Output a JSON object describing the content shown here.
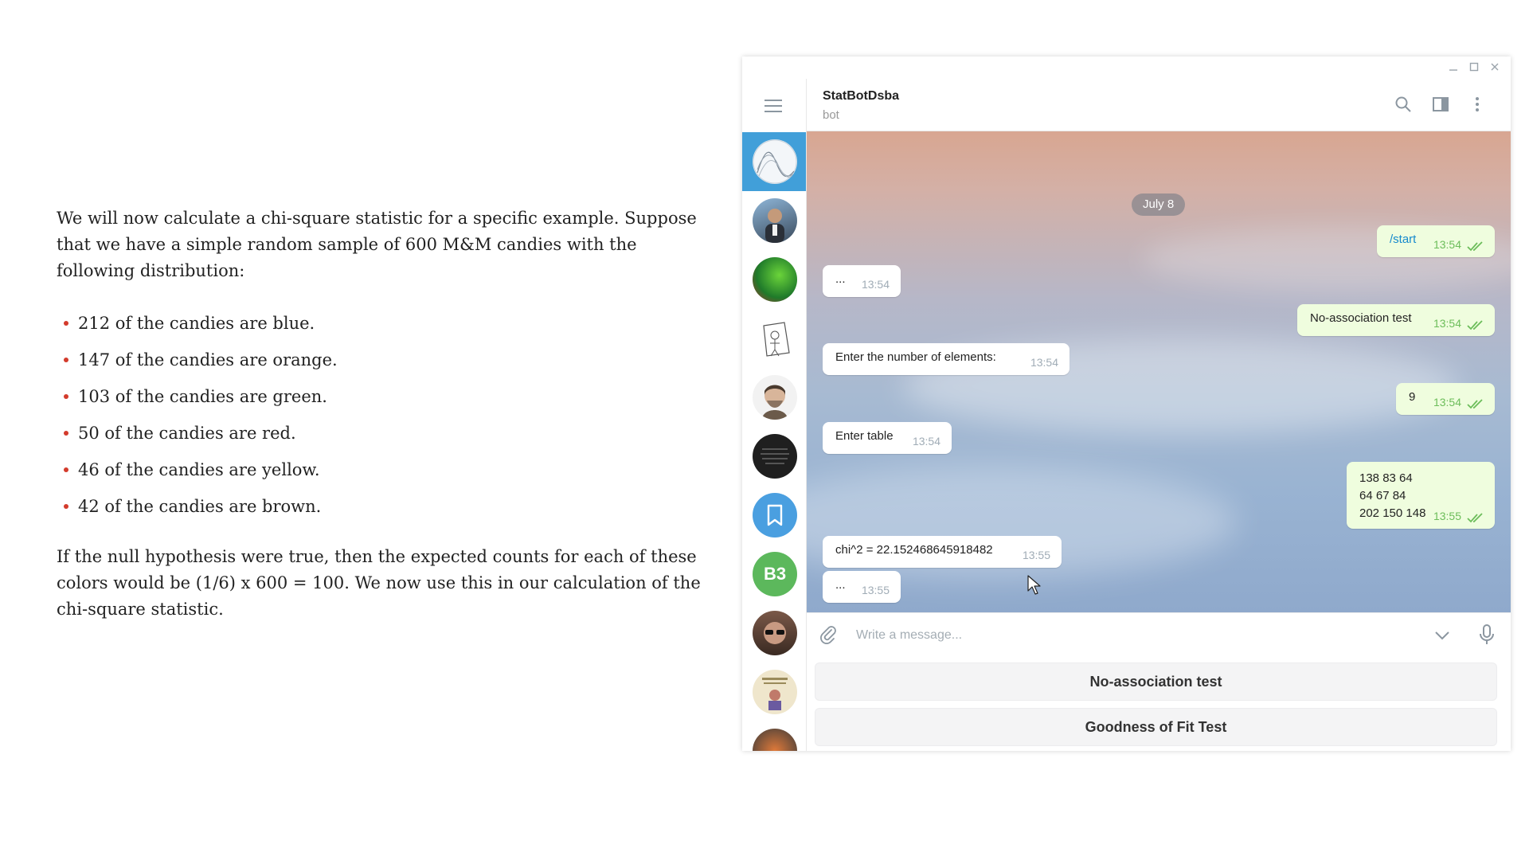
{
  "article": {
    "intro": "We will now calculate a chi-square statistic for a specific example. Suppose that we have a simple random sample of 600 M&M candies with the following distribution:",
    "items": [
      "212 of the candies are blue.",
      "147 of the candies are orange.",
      "103 of the candies are green.",
      "50 of the candies are red.",
      "46 of the candies are yellow.",
      "42 of the candies are brown."
    ],
    "outro": "If the null hypothesis were true, then the expected counts for each of these colors would be (1/6) x 600 = 100. We now use this in our calculation of the chi-square statistic."
  },
  "window": {
    "controls": [
      "minimize-icon",
      "maximize-icon",
      "close-icon"
    ]
  },
  "sidebar": {
    "menu_icon": "hamburger-menu-icon",
    "chats": [
      {
        "name": "statbot-avatar",
        "active": true
      },
      {
        "name": "chat-avatar-2"
      },
      {
        "name": "chat-avatar-3"
      },
      {
        "name": "chat-avatar-4"
      },
      {
        "name": "chat-avatar-5"
      },
      {
        "name": "chat-avatar-6"
      },
      {
        "name": "saved-messages-avatar",
        "icon": "bookmark-icon"
      },
      {
        "name": "chat-avatar-b3",
        "letters": "B3"
      },
      {
        "name": "chat-avatar-9"
      },
      {
        "name": "chat-avatar-10"
      },
      {
        "name": "chat-avatar-11"
      }
    ]
  },
  "header": {
    "title": "StatBotDsba",
    "subtitle": "bot",
    "icons": [
      "search-icon",
      "sidebar-toggle-icon",
      "more-vertical-icon"
    ]
  },
  "chat": {
    "date": "July 8",
    "messages": [
      {
        "dir": "out",
        "text": "/start",
        "time": "13:54"
      },
      {
        "dir": "in",
        "text": "...",
        "time": "13:54"
      },
      {
        "dir": "out",
        "text": "No-association test",
        "time": "13:54"
      },
      {
        "dir": "in",
        "text": "Enter the number of elements:",
        "time": "13:54"
      },
      {
        "dir": "out",
        "text": "9",
        "time": "13:54"
      },
      {
        "dir": "in",
        "text": "Enter table",
        "time": "13:54"
      },
      {
        "dir": "out",
        "lines": [
          "138 83 64",
          "64 67 84",
          "202 150 148"
        ],
        "time": "13:55"
      },
      {
        "dir": "in",
        "text": "chi^2 = 22.152468645918482",
        "time": "13:55"
      },
      {
        "dir": "in",
        "text": "...",
        "time": "13:55"
      }
    ]
  },
  "composer": {
    "placeholder": "Write a message...",
    "icons": [
      "attach-icon",
      "chevron-down-icon",
      "microphone-icon"
    ]
  },
  "keyboard": {
    "buttons": [
      "No-association test",
      "Goodness of Fit Test"
    ]
  },
  "colors": {
    "accent": "#419fd9",
    "outgoing_bubble": "#effdde",
    "check": "#6cbd5a",
    "bullet": "#d33b2c"
  }
}
